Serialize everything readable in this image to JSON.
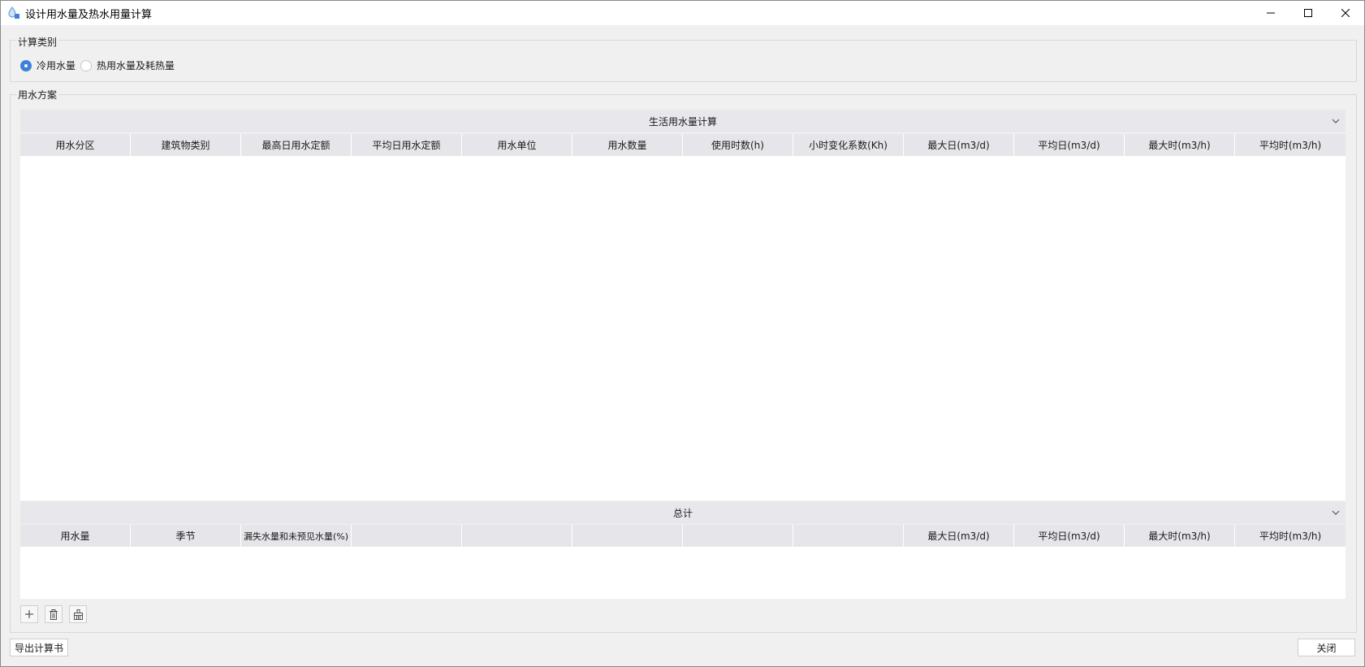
{
  "window": {
    "title": "设计用水量及热水用量计算"
  },
  "calc_type": {
    "label": "计算类别",
    "options": [
      {
        "label": "冷用水量",
        "checked": true
      },
      {
        "label": "热用水量及耗热量",
        "checked": false
      }
    ]
  },
  "plan": {
    "label": "用水方案",
    "domestic": {
      "title": "生活用水量计算",
      "columns": [
        "用水分区",
        "建筑物类别",
        "最高日用水定额",
        "平均日用水定额",
        "用水单位",
        "用水数量",
        "使用时数(h)",
        "小时变化系数(Kh)",
        "最大日(m3/d)",
        "平均日(m3/d)",
        "最大时(m3/h)",
        "平均时(m3/h)"
      ]
    },
    "total": {
      "title": "总计",
      "columns": [
        "用水量",
        "季节",
        "漏失水量和未预见水量(%)",
        "",
        "",
        "",
        "",
        "",
        "最大日(m3/d)",
        "平均日(m3/d)",
        "最大时(m3/h)",
        "平均时(m3/h)"
      ]
    }
  },
  "toolbar": {
    "icons": [
      "plus-icon",
      "trash-icon",
      "brush-icon"
    ]
  },
  "footer": {
    "export_label": "导出计算书",
    "close_label": "关闭"
  }
}
